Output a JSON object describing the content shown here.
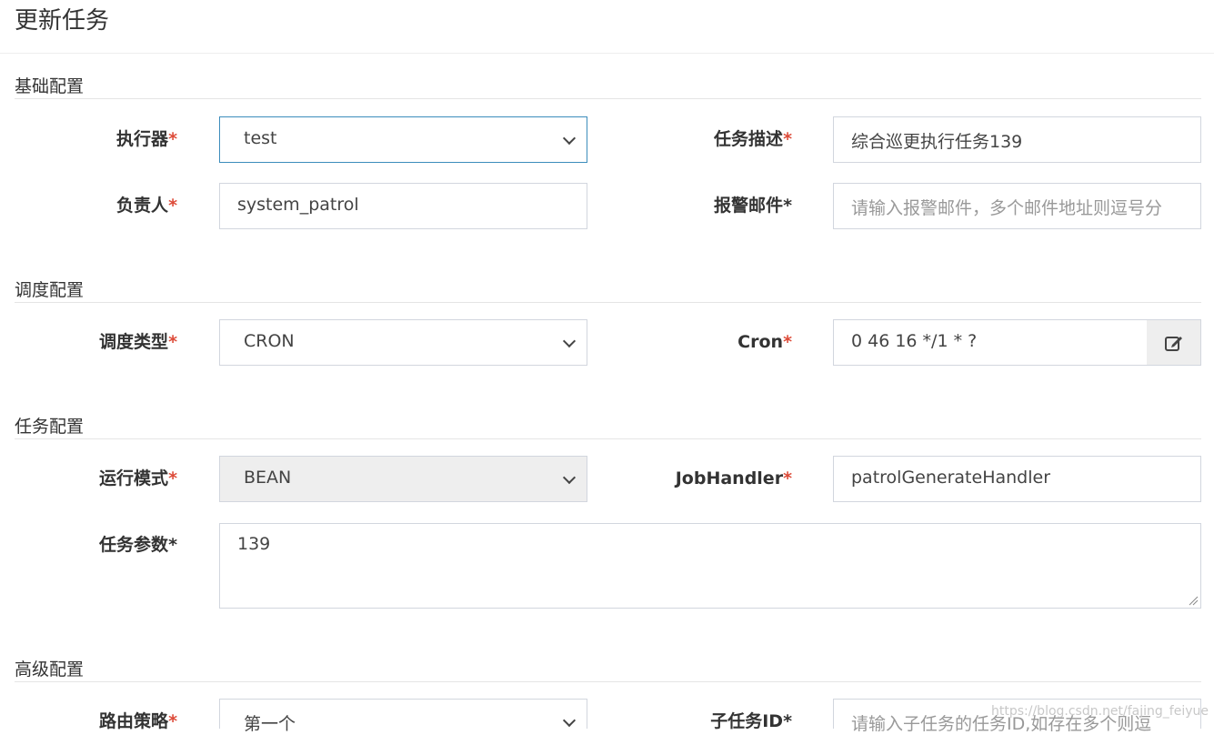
{
  "header": {
    "title": "更新任务"
  },
  "sections": {
    "basic": "基础配置",
    "schedule": "调度配置",
    "task": "任务配置",
    "advanced": "高级配置"
  },
  "fields": {
    "executor": {
      "label": "执行器",
      "required": "*",
      "value": "test"
    },
    "description": {
      "label": "任务描述",
      "required": "*",
      "value": "综合巡更执行任务139"
    },
    "owner": {
      "label": "负责人",
      "required": "*",
      "value": "system_patrol"
    },
    "alarm_email": {
      "label": "报警邮件",
      "required": "*",
      "placeholder": "请输入报警邮件，多个邮件地址则逗号分"
    },
    "schedule_type": {
      "label": "调度类型",
      "required": "*",
      "value": "CRON"
    },
    "cron": {
      "label": "Cron",
      "required": "*",
      "value": "0 46 16 */1 * ?",
      "icon": "edit-icon"
    },
    "run_mode": {
      "label": "运行模式",
      "required": "*",
      "value": "BEAN"
    },
    "job_handler": {
      "label": "JobHandler",
      "required": "*",
      "value": "patrolGenerateHandler"
    },
    "task_params": {
      "label": "任务参数",
      "required": "*",
      "value": "139"
    },
    "route_strategy": {
      "label": "路由策略",
      "required": "*",
      "value": "第一个"
    },
    "child_task_id": {
      "label": "子任务ID",
      "required": "*",
      "placeholder": "请输入子任务的任务ID,如存在多个则逗"
    }
  },
  "watermark": "https://blog.csdn.net/fajing_feiyue",
  "colors": {
    "required": "#dd4b39",
    "focus_border": "#3c8dbc",
    "border": "#d2d6de",
    "disabled_bg": "#eeeeee"
  }
}
